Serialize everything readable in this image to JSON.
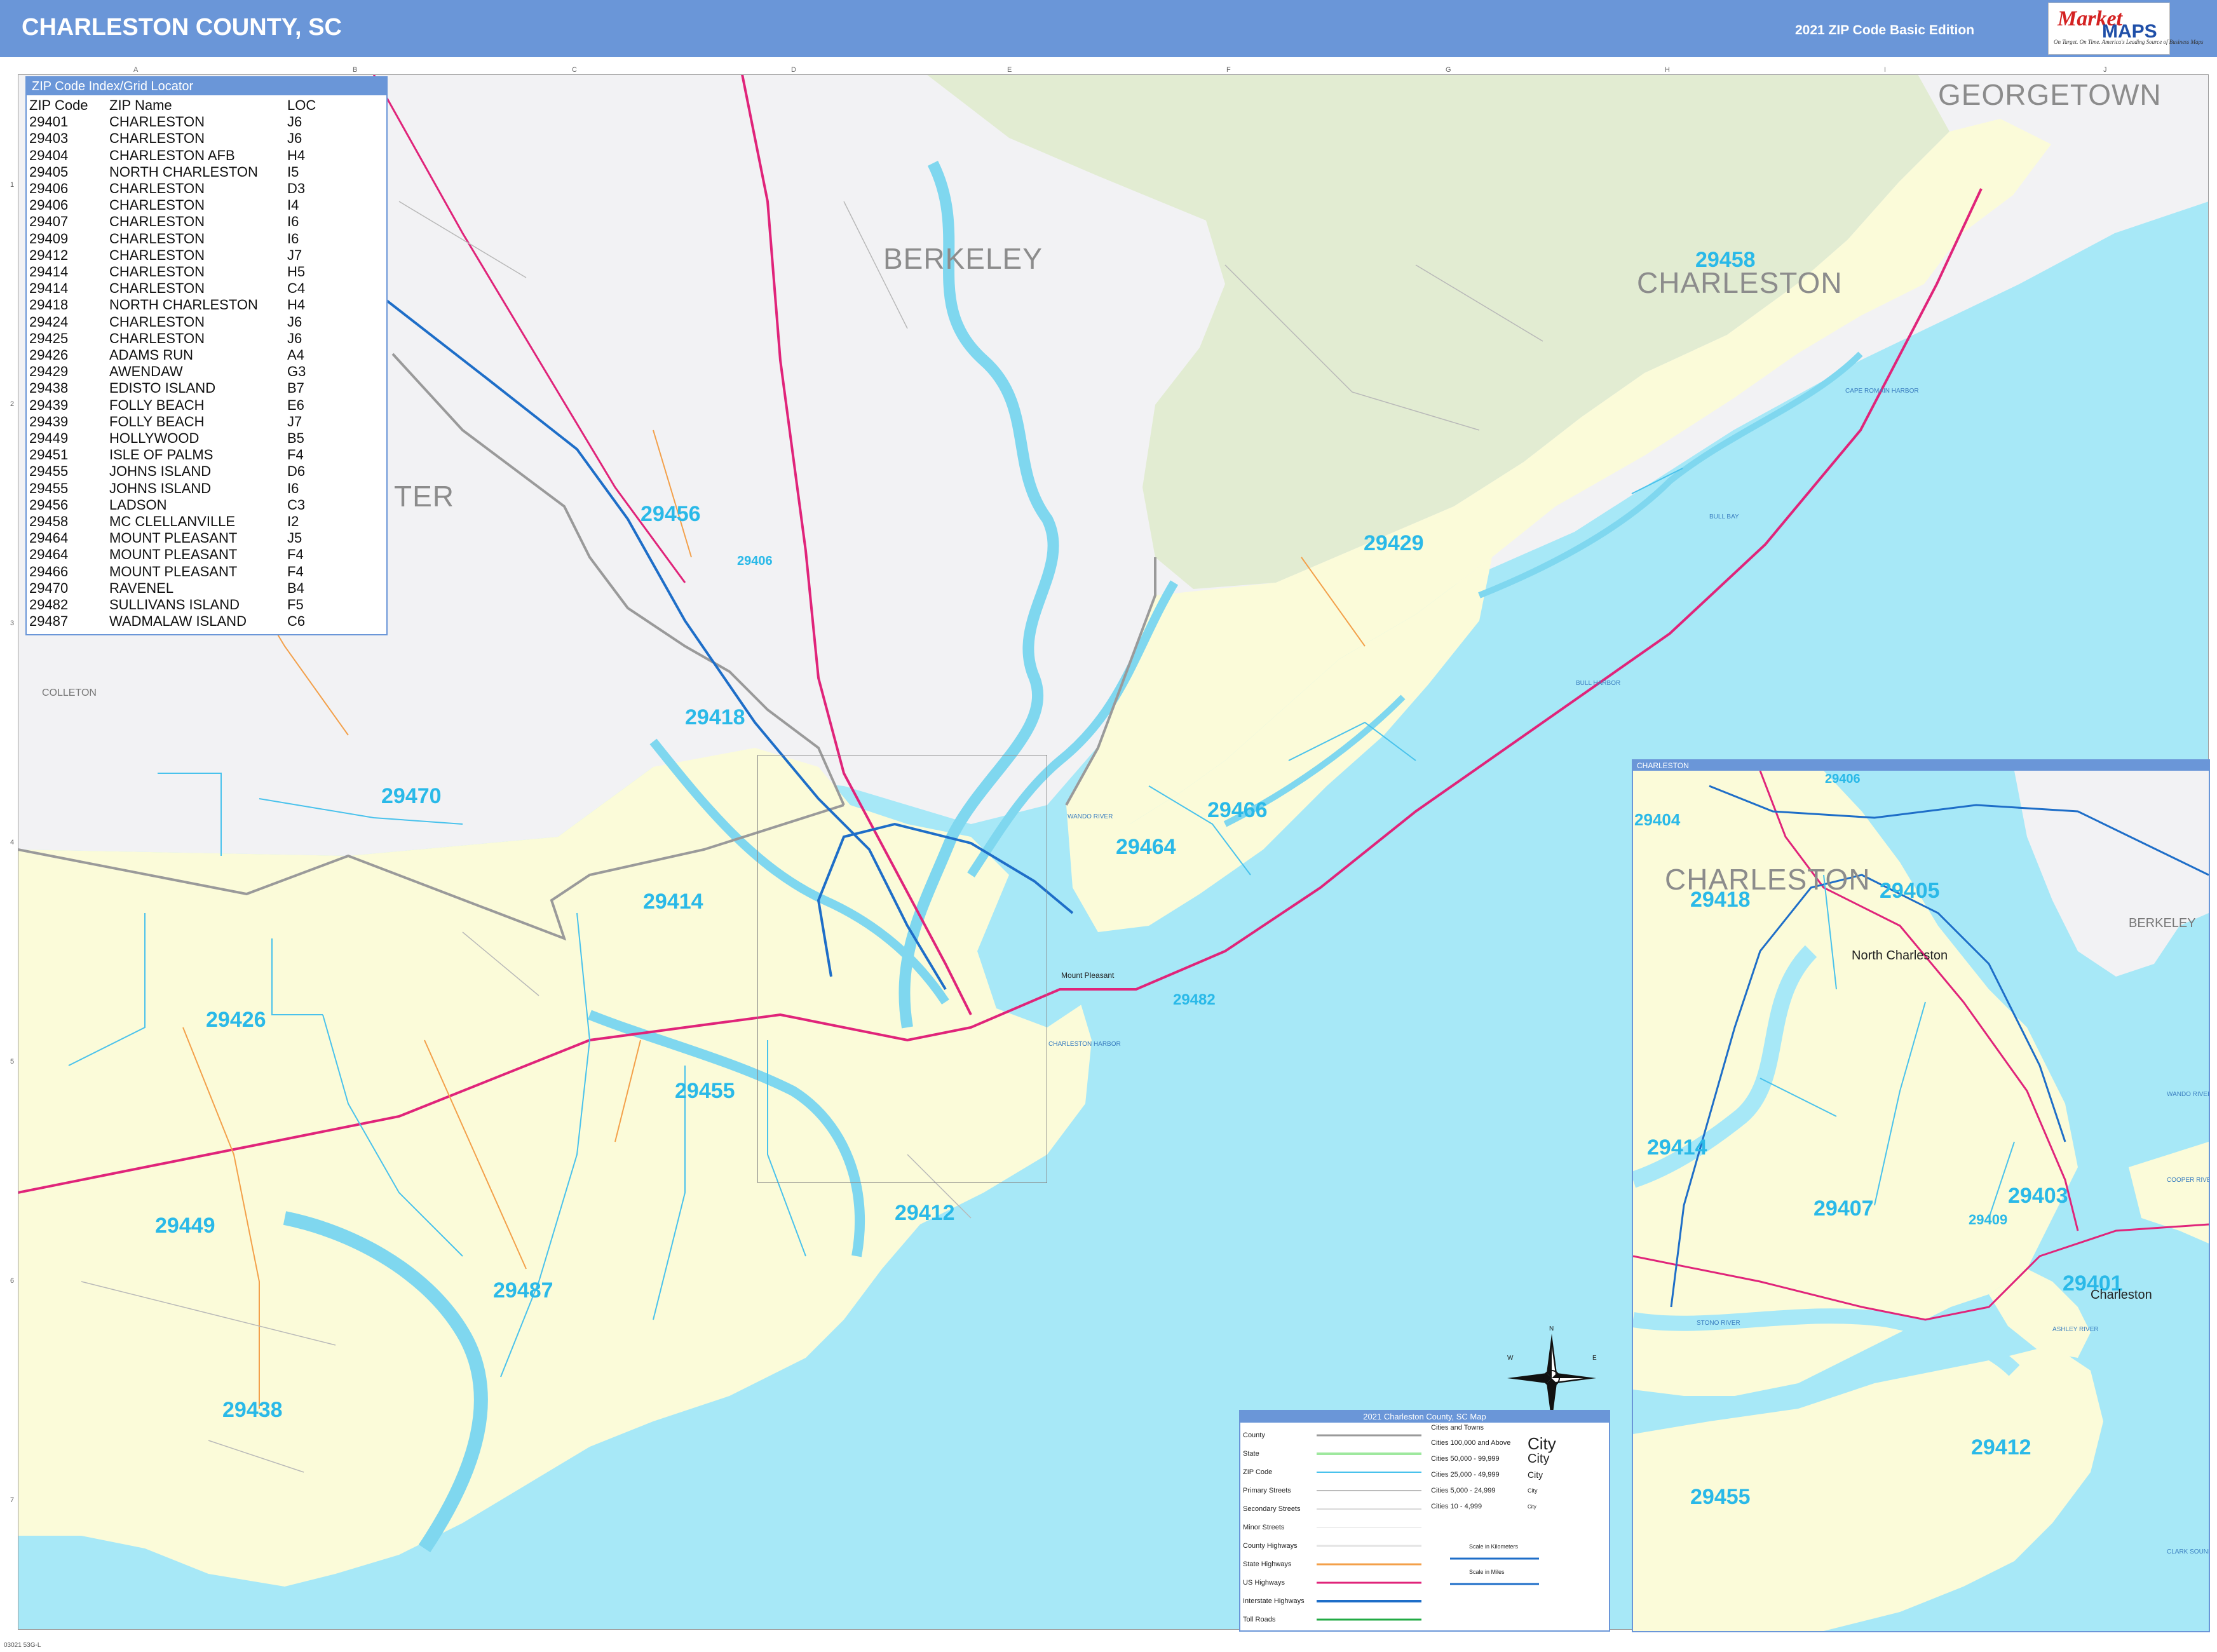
{
  "header": {
    "title": "CHARLESTON COUNTY, SC",
    "edition": "2021 ZIP Code Basic Edition",
    "brand": {
      "name": "Market",
      "maps": "MAPS",
      "tagline": "On Target. On Time. America's Leading Source of Business Maps"
    }
  },
  "zip_index": {
    "title": "ZIP Code Index/Grid Locator",
    "columns": [
      "ZIP Code",
      "ZIP Name",
      "LOC"
    ],
    "rows": [
      [
        "29401",
        "CHARLESTON",
        "J6"
      ],
      [
        "29403",
        "CHARLESTON",
        "J6"
      ],
      [
        "29404",
        "CHARLESTON AFB",
        "H4"
      ],
      [
        "29405",
        "NORTH CHARLESTON",
        "I5"
      ],
      [
        "29406",
        "CHARLESTON",
        "D3"
      ],
      [
        "29406",
        "CHARLESTON",
        "I4"
      ],
      [
        "29407",
        "CHARLESTON",
        "I6"
      ],
      [
        "29409",
        "CHARLESTON",
        "I6"
      ],
      [
        "29412",
        "CHARLESTON",
        "J7"
      ],
      [
        "29414",
        "CHARLESTON",
        "H5"
      ],
      [
        "29414",
        "CHARLESTON",
        "C4"
      ],
      [
        "29418",
        "NORTH CHARLESTON",
        "H4"
      ],
      [
        "29424",
        "CHARLESTON",
        "J6"
      ],
      [
        "29425",
        "CHARLESTON",
        "J6"
      ],
      [
        "29426",
        "ADAMS RUN",
        "A4"
      ],
      [
        "29429",
        "AWENDAW",
        "G3"
      ],
      [
        "29438",
        "EDISTO ISLAND",
        "B7"
      ],
      [
        "29439",
        "FOLLY BEACH",
        "E6"
      ],
      [
        "29439",
        "FOLLY BEACH",
        "J7"
      ],
      [
        "29449",
        "HOLLYWOOD",
        "B5"
      ],
      [
        "29451",
        "ISLE OF PALMS",
        "F4"
      ],
      [
        "29455",
        "JOHNS ISLAND",
        "D6"
      ],
      [
        "29455",
        "JOHNS ISLAND",
        "I6"
      ],
      [
        "29456",
        "LADSON",
        "C3"
      ],
      [
        "29458",
        "MC CLELLANVILLE",
        "I2"
      ],
      [
        "29464",
        "MOUNT PLEASANT",
        "J5"
      ],
      [
        "29464",
        "MOUNT PLEASANT",
        "F4"
      ],
      [
        "29466",
        "MOUNT PLEASANT",
        "F4"
      ],
      [
        "29470",
        "RAVENEL",
        "B4"
      ],
      [
        "29482",
        "SULLIVANS ISLAND",
        "F5"
      ],
      [
        "29487",
        "WADMALAW ISLAND",
        "C6"
      ]
    ]
  },
  "counties": [
    "BERKELEY",
    "CHARLESTON",
    "GEORGETOWN",
    "TER",
    "COLLETON"
  ],
  "zip_labels": [
    "29456",
    "29406",
    "29418",
    "29470",
    "29414",
    "29426",
    "29455",
    "29449",
    "29487",
    "29438",
    "29412",
    "29464",
    "29466",
    "29482",
    "29429",
    "29458"
  ],
  "places": [
    "Mount Pleasant"
  ],
  "water_labels": [
    "CHARLESTON HARBOR",
    "BULL HARBOR",
    "BULL BAY",
    "CAPE ROMAIN HARBOR",
    "WANDO RIVER"
  ],
  "grid": {
    "columns": [
      "A",
      "B",
      "C",
      "D",
      "E",
      "F",
      "G",
      "H",
      "I",
      "J"
    ],
    "rows": [
      "1",
      "2",
      "3",
      "4",
      "5",
      "6",
      "7"
    ]
  },
  "inset": {
    "title": "CHARLESTON",
    "county_labels": [
      "CHARLESTON",
      "BERKELEY"
    ],
    "zip_labels": [
      "29406",
      "29404",
      "29418",
      "29405",
      "29414",
      "29407",
      "29403",
      "29401",
      "29412",
      "29455",
      "29409"
    ],
    "cities": [
      "North Charleston",
      "Charleston"
    ],
    "water_labels": [
      "ASHLEY RIVER",
      "STONO RIVER",
      "WANDO RIVER",
      "COOPER RIVER",
      "CLARK SOUND"
    ]
  },
  "legend": {
    "title": "2021 Charleston County, SC Map",
    "line_types": [
      "County",
      "State",
      "ZIP Code",
      "Primary Streets",
      "Secondary Streets",
      "Minor Streets",
      "County Highways",
      "State Highways",
      "US Highways",
      "Interstate Highways",
      "Toll Roads"
    ],
    "cities_header": "Cities and Towns",
    "city_classes": [
      {
        "label": "Cities 100,000 and Above",
        "sample": "City"
      },
      {
        "label": "Cities 50,000 - 99,999",
        "sample": "City"
      },
      {
        "label": "Cities 25,000 - 49,999",
        "sample": "City"
      },
      {
        "label": "Cities 5,000 - 24,999",
        "sample": "City"
      },
      {
        "label": "Cities 10 - 4,999",
        "sample": "City"
      }
    ],
    "scale_km": "Scale in Kilometers",
    "scale_mi": "Scale in Miles"
  },
  "compass": {
    "n": "N",
    "s": "S",
    "e": "E",
    "w": "W"
  },
  "footer_code": "03021 53G-L",
  "colors": {
    "header": "#6a96d8",
    "water": "#a7e8f7",
    "county_land": "#fbfbd9",
    "outside_land": "#f2f2f4",
    "forest": "#e2ecd2",
    "zip_label": "#2ab9e8",
    "us_highway": "#e0247a",
    "interstate": "#1e6ec8"
  },
  "icons": [
    "compass-rose-icon",
    "market-maps-logo-icon"
  ]
}
